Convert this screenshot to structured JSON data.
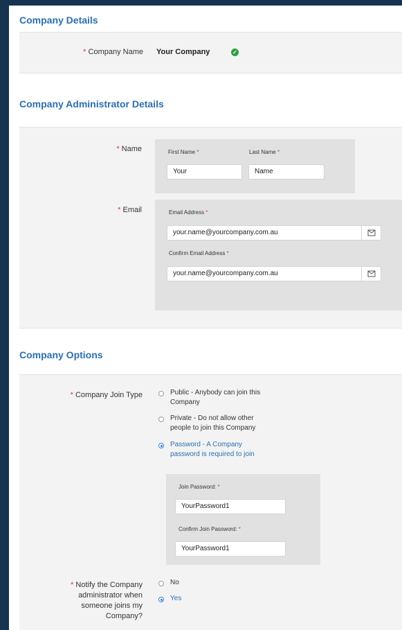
{
  "company_details": {
    "title": "Company Details",
    "company_name_label": "Company Name",
    "company_name_value": "Your Company"
  },
  "admin_details": {
    "title": "Company Administrator Details",
    "name_label": "Name",
    "first_name_label": "First Name",
    "first_name_value": "Your",
    "last_name_label": "Last Name",
    "last_name_value": "Name",
    "email_label": "Email",
    "email_address_label": "Email Address",
    "email_address_value": "your.name@yourcompany.com.au",
    "confirm_email_label": "Confirm Email Address",
    "confirm_email_value": "your.name@yourcompany.com.au"
  },
  "company_options": {
    "title": "Company Options",
    "join_type_label": "Company Join Type",
    "join_options": [
      {
        "line1": "Public - Anybody can join this",
        "line2": "Company",
        "selected": false
      },
      {
        "line1": "Private - Do not allow other",
        "line2": "people to join this Company",
        "selected": false
      },
      {
        "line1": "Password - A Company",
        "line2": "password is required to join",
        "selected": true
      }
    ],
    "join_password_label": "Join Password:",
    "join_password_value": "YourPassword1",
    "confirm_join_password_label": "Confirm Join Password:",
    "confirm_join_password_value": "YourPassword1",
    "notify_label_lines": [
      "Notify the Company",
      "administrator when",
      "someone joins my",
      "Company?"
    ],
    "notify_options": [
      {
        "label": "No",
        "selected": false
      },
      {
        "label": "Yes",
        "selected": true
      }
    ]
  },
  "required_marker": "*",
  "colors": {
    "frame_background": "#16344f",
    "section_title": "#2a6fb0",
    "required": "#d43b3b",
    "selected": "#3a7bd5",
    "verified": "#2f9e3f"
  }
}
